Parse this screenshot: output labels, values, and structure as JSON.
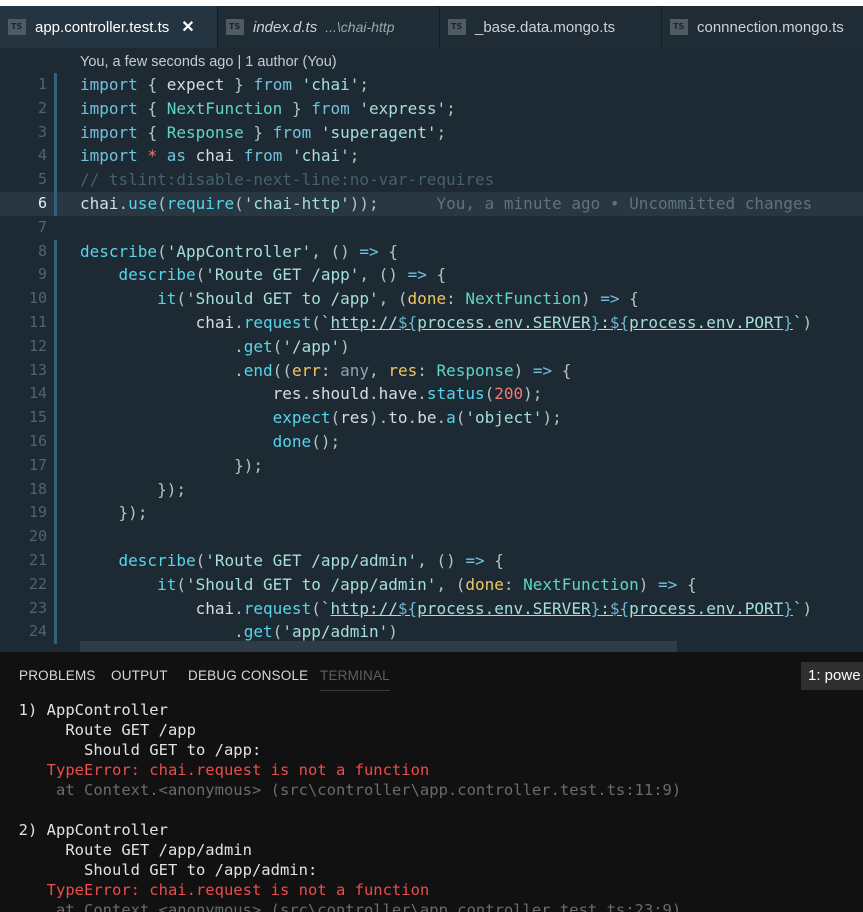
{
  "tabs": [
    {
      "name": "app.controller.test.ts",
      "desc": "",
      "close": "✕"
    },
    {
      "name": "index.d.ts",
      "desc": "...\\chai-http"
    },
    {
      "name": "_base.data.mongo.ts",
      "desc": ""
    },
    {
      "name": "connnection.mongo.ts",
      "desc": ""
    }
  ],
  "ts_badge": "TS",
  "editor": {
    "blame_header": "You, a few seconds ago | 1 author (You)",
    "ghost_annotation": "You, a minute ago • Uncommitted changes",
    "line_numbers": [
      "1",
      "2",
      "3",
      "4",
      "5",
      "6",
      "7",
      "8",
      "9",
      "10",
      "11",
      "12",
      "13",
      "14",
      "15",
      "16",
      "17",
      "18",
      "19",
      "20",
      "21",
      "22",
      "23",
      "24"
    ],
    "current_line": 6,
    "lines": [
      "import { expect } from 'chai';",
      "import { NextFunction } from 'express';",
      "import { Response } from 'superagent';",
      "import * as chai from 'chai';",
      "// tslint:disable-next-line:no-var-requires",
      "chai.use(require('chai-http'));",
      "",
      "describe('AppController', () => {",
      "    describe('Route GET /app', () => {",
      "        it('Should GET to /app', (done: NextFunction) => {",
      "            chai.request(`http://${process.env.SERVER}:${process.env.PORT}`)",
      "                .get('/app')",
      "                .end((err: any, res: Response) => {",
      "                    res.should.have.status(200);",
      "                    expect(res).to.be.a('object');",
      "                    done();",
      "                });",
      "        });",
      "    });",
      "",
      "    describe('Route GET /app/admin', () => {",
      "        it('Should GET to /app/admin', (done: NextFunction) => {",
      "            chai.request(`http://${process.env.SERVER}:${process.env.PORT}`)",
      "                .get('app/admin')"
    ]
  },
  "panel": {
    "tabs": [
      "PROBLEMS",
      "OUTPUT",
      "DEBUG CONSOLE",
      "TERMINAL"
    ],
    "active_tab": "TERMINAL",
    "terminal_select": "1: powe",
    "terminal_lines": [
      "  1) AppController",
      "       Route GET /app",
      "         Should GET to /app:",
      "     TypeError: chai.request is not a function",
      "      at Context.<anonymous> (src\\controller\\app.controller.test.ts:11:9)",
      "",
      "  2) AppController",
      "       Route GET /app/admin",
      "         Should GET to /app/admin:",
      "     TypeError: chai.request is not a function",
      "      at Context.<anonymous> (src\\controller\\app.controller.test.ts:23:9)"
    ]
  },
  "colors": {
    "editor_bg": "#1e2a33",
    "keyword": "#6fc3df",
    "string": "#a5dfda",
    "param": "#f0c75e",
    "error": "#ee4b4b",
    "panel_bg": "#111111"
  }
}
